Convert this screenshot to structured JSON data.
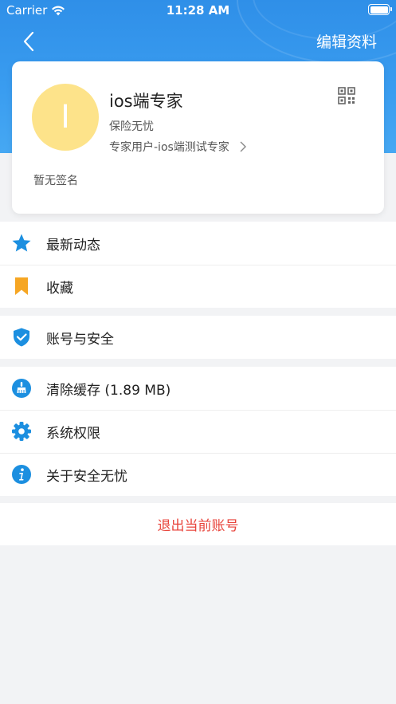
{
  "status_bar": {
    "carrier": "Carrier",
    "time": "11:28 AM"
  },
  "nav": {
    "edit_label": "编辑资料"
  },
  "profile": {
    "avatar_letter": "I",
    "name": "ios端专家",
    "subtitle": "保险无忧",
    "role": "专家用户-ios端测试专家",
    "signature": "暂无签名"
  },
  "menu": {
    "group1": [
      {
        "label": "最新动态",
        "icon": "star-icon"
      },
      {
        "label": "收藏",
        "icon": "bookmark-icon"
      }
    ],
    "group2": [
      {
        "label": "账号与安全",
        "icon": "shield-check-icon"
      }
    ],
    "group3": [
      {
        "label": "清除缓存 (1.89 MB)",
        "icon": "broom-icon"
      },
      {
        "label": "系统权限",
        "icon": "gear-icon"
      },
      {
        "label": "关于安全无忧",
        "icon": "info-icon"
      }
    ]
  },
  "logout_label": "退出当前账号",
  "colors": {
    "header_blue": "#3a9df0",
    "icon_blue": "#1c8fe0",
    "bookmark_orange": "#f6a623",
    "logout_red": "#e8453c",
    "avatar_yellow": "#fde38a"
  }
}
